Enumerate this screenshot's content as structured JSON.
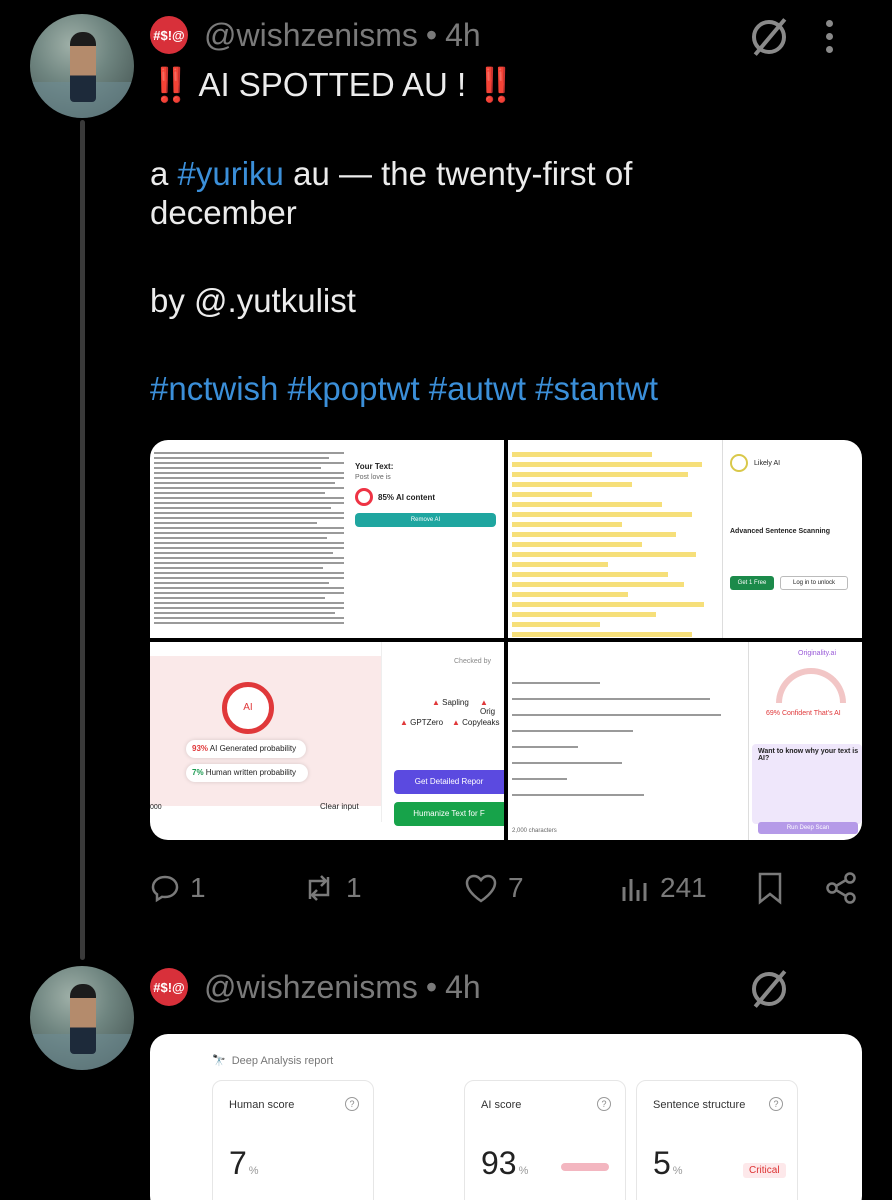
{
  "post1": {
    "handle": "@wishzenisms",
    "time": "4h",
    "emoji": "#$!@",
    "headline_mark": "‼️",
    "headline": "AI SPOTTED AU !",
    "line1_pre": "a ",
    "line1_tag": "#yuriku",
    "line1_post": " au — the twenty-first of",
    "line2": "december",
    "byline": "by @.yutkulist",
    "tags": "#nctwish #kpoptwt #autwt #stantwt",
    "stats": {
      "replies": "1",
      "reposts": "1",
      "likes": "7",
      "views": "241"
    }
  },
  "media": {
    "p1": {
      "your_text": "Your Text:",
      "sub": "Post love is",
      "score": "85% AI content",
      "button": "Remove AI"
    },
    "p2": {
      "badge": "Likely AI",
      "title": "Advanced Sentence Scanning",
      "cta": "Get 1 Free",
      "login": "Log in to unlock"
    },
    "p3": {
      "ai": "AI",
      "gen_pct": "93%",
      "gen_label": "AI Generated probability",
      "human_pct": "7%",
      "human_label": "Human written probability",
      "checked": "Checked by",
      "d1": "Sapling",
      "d2": "Orig",
      "d3": "GPTZero",
      "d4": "Copyleaks",
      "btn1": "Get Detailed Repor",
      "btn2": "Humanize Text for F",
      "clear": "Clear input",
      "count": "000"
    },
    "p4": {
      "brand": "Originality.ai",
      "confident": "69% Confident That's AI",
      "ask": "Want to know why your text is AI?",
      "deep": "Run Deep Scan",
      "chars": "2,000 characters"
    }
  },
  "post2": {
    "handle": "@wishzenisms",
    "time": "4h",
    "emoji": "#$!@",
    "report": "Deep Analysis report",
    "human_label": "Human score",
    "human_val": "7",
    "ai_label": "AI score",
    "ai_val": "93",
    "struct_label": "Sentence structure",
    "struct_val": "5",
    "pct": "%",
    "critical": "Critical"
  }
}
